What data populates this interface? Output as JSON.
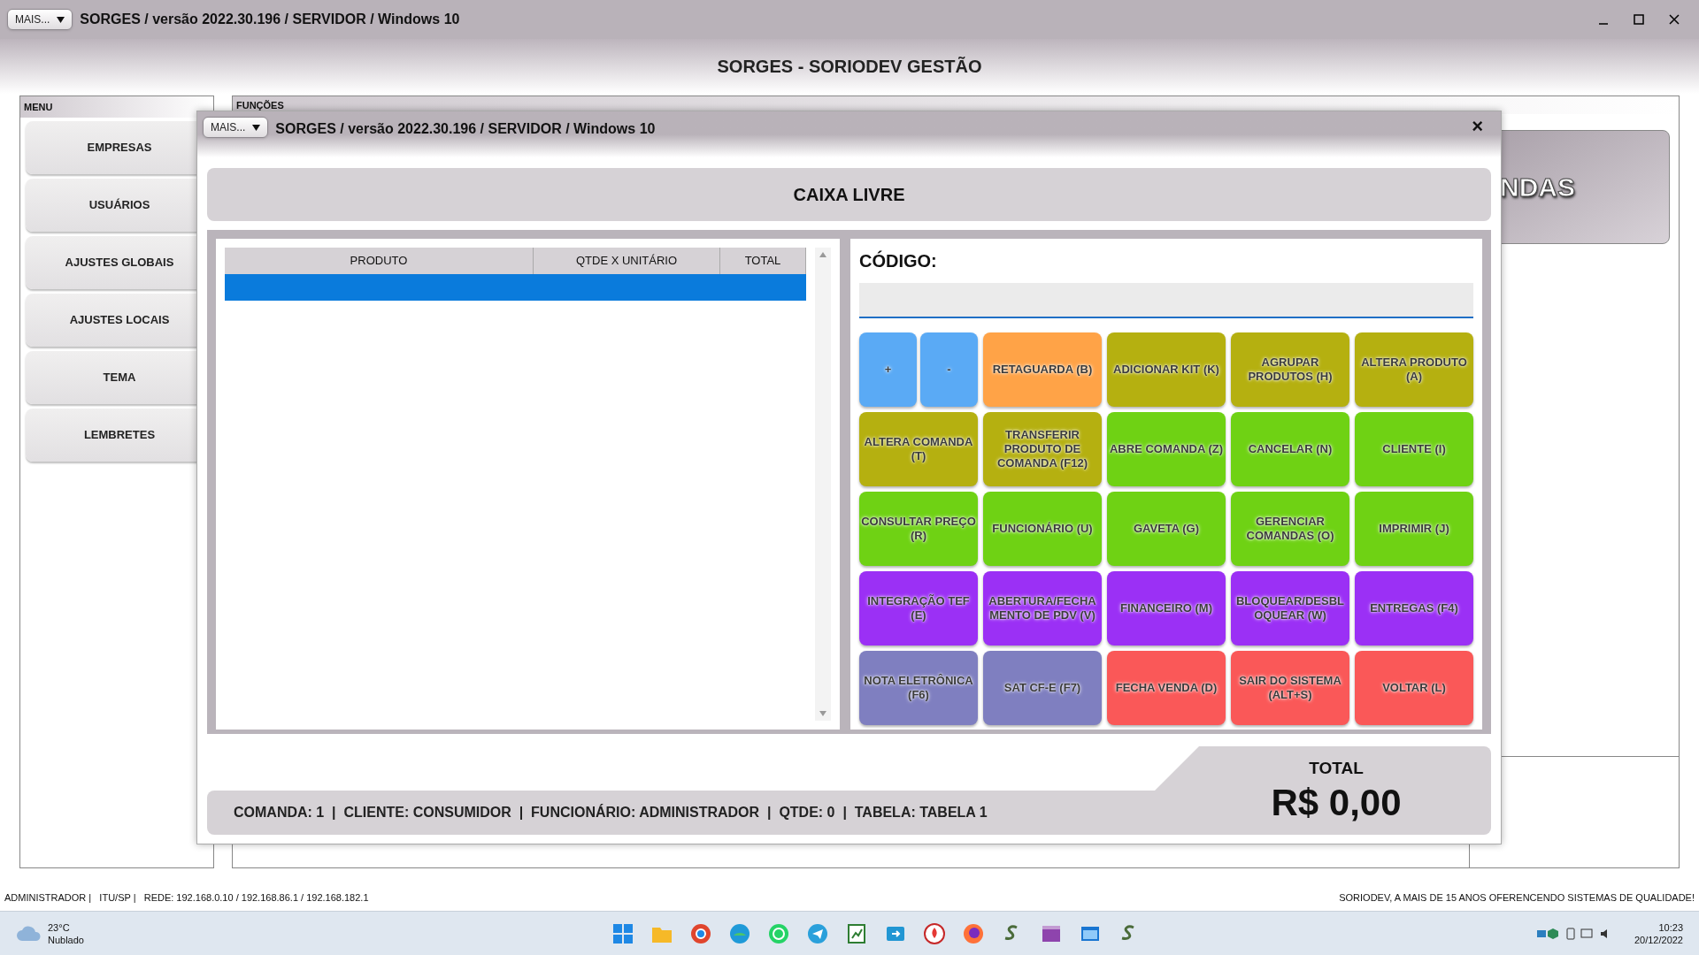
{
  "window": {
    "menu_button": "MAIS...",
    "title": "SORGES / versão 2022.30.196 / SERVIDOR / Windows 10"
  },
  "app_title": "SORGES - SORIODEV GESTÃO",
  "menu": {
    "title": "MENU",
    "items": [
      "EMPRESAS",
      "USUÁRIOS",
      "AJUSTES GLOBAIS",
      "AJUSTES LOCAIS",
      "TEMA",
      "LEMBRETES"
    ]
  },
  "functions": {
    "title": "FUNÇÕES",
    "card_text": "NDAS"
  },
  "dialog": {
    "menu_button": "MAIS...",
    "title": "SORGES / versão 2022.30.196 / SERVIDOR / Windows 10",
    "close": "×",
    "heading": "CAIXA LIVRE",
    "table": {
      "columns": [
        "PRODUTO",
        "QTDE X UNITÁRIO",
        "TOTAL"
      ],
      "rows": [
        {
          "selected": true
        }
      ]
    },
    "code_label": "CÓDIGO:",
    "buttons": [
      {
        "label": "+",
        "color": "#5aaaf5",
        "kind": "half"
      },
      {
        "label": "-",
        "color": "#5aaaf5",
        "kind": "half"
      },
      {
        "label": "RETAGUARDA (B)",
        "color": "#ffa347",
        "kind": "full"
      },
      {
        "label": "ADICIONAR KIT (K)",
        "color": "#b5b010",
        "kind": "full"
      },
      {
        "label": "AGRUPAR PRODUTOS (H)",
        "color": "#b5b010",
        "kind": "full"
      },
      {
        "label": "ALTERA PRODUTO (A)",
        "color": "#b5b010",
        "kind": "full"
      },
      {
        "label": "ALTERA COMANDA (T)",
        "color": "#b5b010",
        "kind": "full"
      },
      {
        "label": "TRANSFERIR PRODUTO DE COMANDA (F12)",
        "color": "#b5b010",
        "kind": "full"
      },
      {
        "label": "ABRE COMANDA (Z)",
        "color": "#6fd214",
        "kind": "full"
      },
      {
        "label": "CANCELAR (N)",
        "color": "#6fd214",
        "kind": "full"
      },
      {
        "label": "CLIENTE (I)",
        "color": "#6fd214",
        "kind": "full"
      },
      {
        "label": "CONSULTAR PREÇO (R)",
        "color": "#6fd214",
        "kind": "full"
      },
      {
        "label": "FUNCIONÁRIO (U)",
        "color": "#6fd214",
        "kind": "full"
      },
      {
        "label": "GAVETA (G)",
        "color": "#6fd214",
        "kind": "full"
      },
      {
        "label": "GERENCIAR COMANDAS (O)",
        "color": "#6fd214",
        "kind": "full"
      },
      {
        "label": "IMPRIMIR (J)",
        "color": "#6fd214",
        "kind": "full"
      },
      {
        "label": "INTEGRAÇÃO TEF (E)",
        "color": "#9b30f5",
        "kind": "full"
      },
      {
        "label": "ABERTURA/FECHAMENTO DE PDV (V)",
        "color": "#9b30f5",
        "kind": "full"
      },
      {
        "label": "FINANCEIRO (M)",
        "color": "#9b30f5",
        "kind": "full"
      },
      {
        "label": "BLOQUEAR/DESBLOQUEAR (W)",
        "color": "#9b30f5",
        "kind": "full"
      },
      {
        "label": "ENTREGAS (F4)",
        "color": "#9b30f5",
        "kind": "full"
      },
      {
        "label": "NOTA ELETRÔNICA (F6)",
        "color": "#7f7fc0",
        "kind": "full"
      },
      {
        "label": "SAT CF-E (F7)",
        "color": "#7f7fc0",
        "kind": "full"
      },
      {
        "label": "FECHA VENDA (D)",
        "color": "#fa5858",
        "kind": "full"
      },
      {
        "label": "SAIR DO SISTEMA (ALT+S)",
        "color": "#fa5858",
        "kind": "full"
      },
      {
        "label": "VOLTAR (L)",
        "color": "#fa5858",
        "kind": "full"
      }
    ],
    "info": "COMANDA: 1  |  CLIENTE: CONSUMIDOR  |  FUNCIONÁRIO: ADMINISTRADOR  |  QTDE: 0  |  TABELA: TABELA 1",
    "total_label": "TOTAL",
    "total_value": "R$ 0,00"
  },
  "status_bar": {
    "left": "ADMINISTRADOR |   ITU/SP |   REDE: 192.168.0.10 / 192.168.86.1 / 192.168.182.1",
    "right": "SORIODEV, A MAIS DE 15 ANOS OFERENCENDO SISTEMAS DE QUALIDADE!"
  },
  "taskbar": {
    "temperature": "23°C",
    "weather": "Nublado",
    "time": "10:23",
    "date": "20/12/2022"
  }
}
